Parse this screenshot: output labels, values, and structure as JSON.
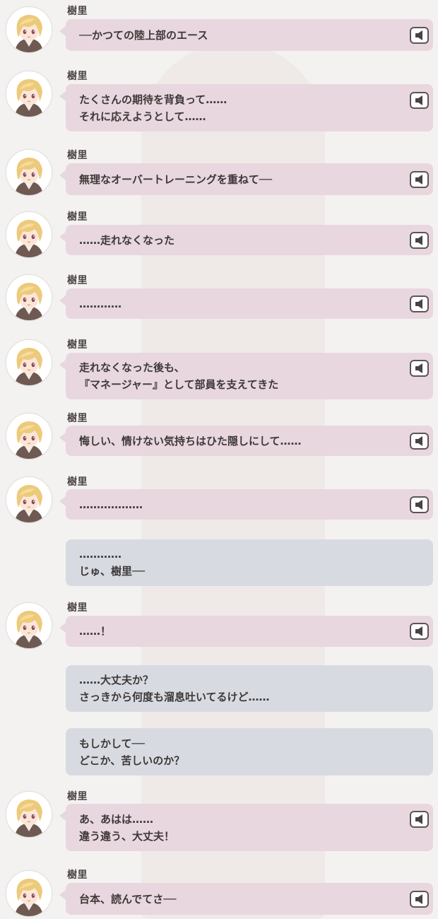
{
  "speaker_name": "樹里",
  "messages": [
    {
      "type": "character",
      "speaker": "樹里",
      "lines": [
        "──かつての陸上部のエース"
      ],
      "has_voice": true
    },
    {
      "type": "character",
      "speaker": "樹里",
      "lines": [
        "たくさんの期待を背負って……",
        "それに応えようとして……"
      ],
      "has_voice": true
    },
    {
      "type": "character",
      "speaker": "樹里",
      "lines": [
        "無理なオーバートレーニングを重ねて──"
      ],
      "has_voice": true
    },
    {
      "type": "character",
      "speaker": "樹里",
      "lines": [
        "……走れなくなった"
      ],
      "has_voice": true
    },
    {
      "type": "character",
      "speaker": "樹里",
      "lines": [
        "…………"
      ],
      "has_voice": true
    },
    {
      "type": "character",
      "speaker": "樹里",
      "lines": [
        "走れなくなった後も、",
        "『マネージャー』として部員を支えてきた"
      ],
      "has_voice": true
    },
    {
      "type": "character",
      "speaker": "樹里",
      "lines": [
        "悔しい、情けない気持ちはひた隠しにして……"
      ],
      "has_voice": true
    },
    {
      "type": "character",
      "speaker": "樹里",
      "lines": [
        "………………"
      ],
      "has_voice": true
    },
    {
      "type": "player",
      "lines": [
        "…………",
        "じゅ、樹里──"
      ]
    },
    {
      "type": "character",
      "speaker": "樹里",
      "lines": [
        "……！"
      ],
      "has_voice": true
    },
    {
      "type": "player",
      "lines": [
        "……大丈夫か？",
        "さっきから何度も溜息吐いてるけど……"
      ]
    },
    {
      "type": "player",
      "lines": [
        "もしかして──",
        "どこか、苦しいのか？"
      ]
    },
    {
      "type": "character",
      "speaker": "樹里",
      "lines": [
        "あ、あはは……",
        "違う違う、大丈夫！"
      ],
      "has_voice": true
    },
    {
      "type": "character",
      "speaker": "樹里",
      "lines": [
        "台本、読んでてさ──"
      ],
      "has_voice": true
    }
  ],
  "icons": {
    "voice": "speaker-icon",
    "avatar": "character-portrait"
  },
  "colors": {
    "character_bubble": "#e8d7df",
    "player_bubble": "#d7dbe1",
    "text": "#3e3838",
    "voice_border": "#5d5457"
  }
}
